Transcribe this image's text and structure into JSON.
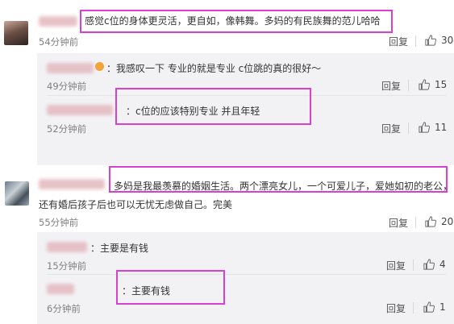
{
  "comments": [
    {
      "name_tail": "",
      "text": "感觉c位的身体更灵活，更自如，像韩舞。多妈的有民族舞的范儿哈哈",
      "time": "54分钟前",
      "reply_label": "回复",
      "likes": "304",
      "replies": [
        {
          "text": "：我感叹一下 专业的就是专业 c位跳的真的很好～",
          "time": "49分钟前",
          "reply_label": "回复",
          "likes": "15"
        },
        {
          "text": "：c位的应该特别专业 并且年轻",
          "time": "52分钟前",
          "reply_label": "回复",
          "likes": "11"
        }
      ]
    },
    {
      "name_tail": "",
      "text_line1": "多妈是我最羡慕的婚姻生活。两个漂亮女儿，一个可爱儿子，爱她如初的老公，",
      "text_line2": "还有婚后孩子后也可以无忧无虑做自己。完美",
      "time": "55分钟前",
      "reply_label": "回复",
      "likes": "207",
      "replies": [
        {
          "text": "：主要是有钱",
          "time": "15分钟前",
          "reply_label": "回复",
          "likes": "4"
        },
        {
          "text": "：主要有钱",
          "time": "6分钟前",
          "reply_label": "回复",
          "likes": "1"
        }
      ]
    }
  ],
  "colors": {
    "highlight": "#d83fd3",
    "name_blur": "#e3b8bf",
    "sub_bg": "#f2f2f5"
  },
  "icons": {
    "like": "thumbs-up-icon",
    "verified": "badge-icon"
  }
}
